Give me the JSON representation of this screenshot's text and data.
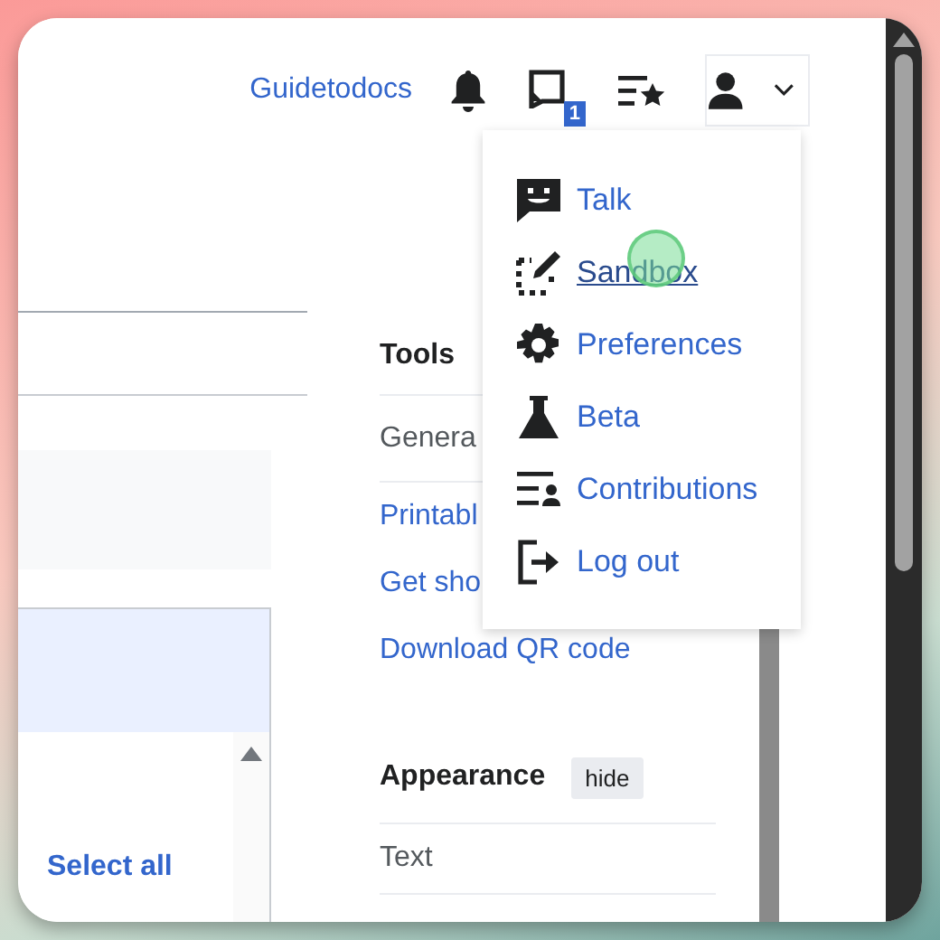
{
  "header": {
    "username": "Guidetodocs",
    "notice_count": "1"
  },
  "user_menu": {
    "items": [
      {
        "label": "Talk",
        "kind": "talk",
        "hovered": false
      },
      {
        "label": "Sandbox",
        "kind": "sandbox",
        "hovered": true
      },
      {
        "label": "Preferences",
        "kind": "preferences",
        "hovered": false
      },
      {
        "label": "Beta",
        "kind": "beta",
        "hovered": false
      },
      {
        "label": "Contributions",
        "kind": "contributions",
        "hovered": false
      },
      {
        "label": "Log out",
        "kind": "logout",
        "hovered": false
      }
    ]
  },
  "tools": {
    "title": "Tools",
    "items": [
      {
        "label": "Genera",
        "kind": "plain"
      },
      {
        "label": "Printabl",
        "kind": "link"
      },
      {
        "label": "Get sho",
        "kind": "link"
      },
      {
        "label": "Download QR code",
        "kind": "link"
      }
    ]
  },
  "appearance": {
    "title": "Appearance",
    "toggle": "hide",
    "items": [
      "Text"
    ]
  },
  "left_panel": {
    "action": "Select all"
  }
}
